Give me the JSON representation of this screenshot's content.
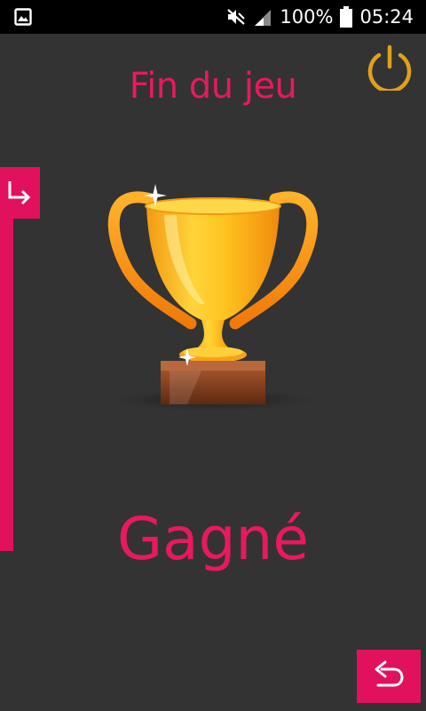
{
  "status_bar": {
    "battery": "100%",
    "time": "05:24",
    "icons": [
      "gallery-notification-icon",
      "mute-icon",
      "signal-icon",
      "battery-icon"
    ]
  },
  "header": {
    "title": "Fin du jeu",
    "power_icon": "power-icon"
  },
  "sidebar": {
    "toggle_icon": "arrow-down-right-icon"
  },
  "main": {
    "trophy_icon": "trophy-icon",
    "result": "Gagné"
  },
  "footer": {
    "back_icon": "undo-arrow-icon"
  },
  "colors": {
    "background": "#333333",
    "accent": "#e2115d",
    "text_accent": "#e8195e",
    "power_icon": "#e0a01a",
    "status_bar": "#000000"
  }
}
